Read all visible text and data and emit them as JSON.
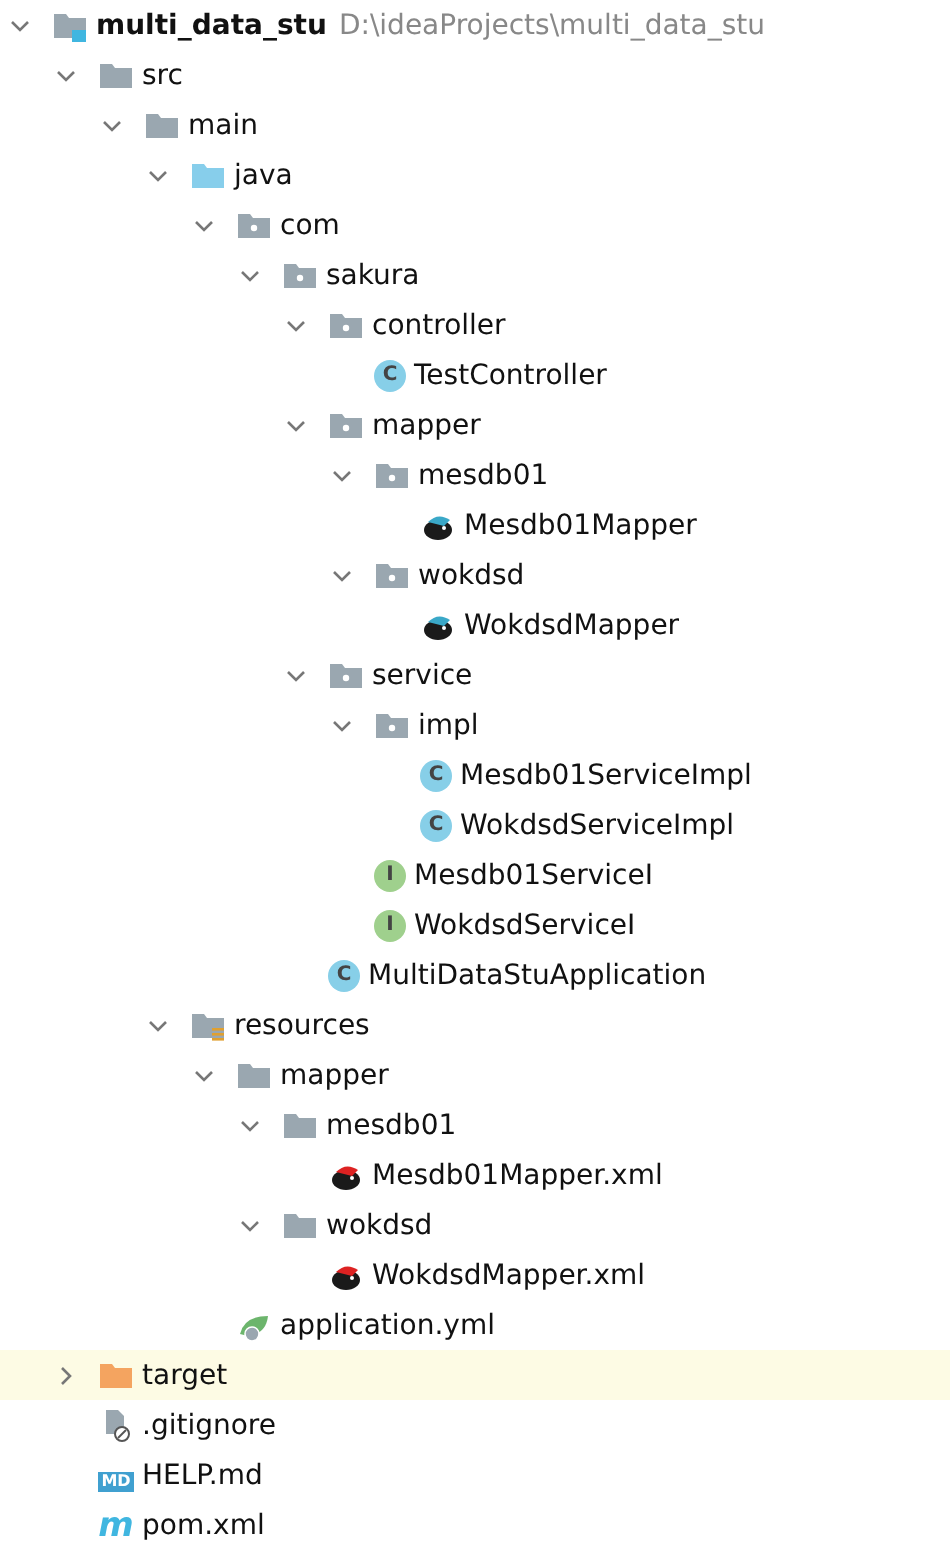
{
  "tree": [
    {
      "kind": "module",
      "name": "multi_data_stu",
      "path": "D:\\ideaProjects\\multi_data_stu",
      "expanded": true,
      "selected": false,
      "children": [
        {
          "kind": "folder",
          "name": "src",
          "expanded": true,
          "selected": false,
          "children": [
            {
              "kind": "folder",
              "name": "main",
              "expanded": true,
              "selected": false,
              "children": [
                {
                  "kind": "source-folder",
                  "name": "java",
                  "expanded": true,
                  "selected": false,
                  "children": [
                    {
                      "kind": "package",
                      "name": "com",
                      "expanded": true,
                      "selected": false,
                      "children": [
                        {
                          "kind": "package",
                          "name": "sakura",
                          "expanded": true,
                          "selected": false,
                          "children": [
                            {
                              "kind": "package",
                              "name": "controller",
                              "expanded": true,
                              "selected": false,
                              "children": [
                                {
                                  "kind": "class",
                                  "name": "TestController",
                                  "icon_label": "C",
                                  "selected": false
                                }
                              ]
                            },
                            {
                              "kind": "package",
                              "name": "mapper",
                              "expanded": true,
                              "selected": false,
                              "children": [
                                {
                                  "kind": "package",
                                  "name": "mesdb01",
                                  "expanded": true,
                                  "selected": false,
                                  "children": [
                                    {
                                      "kind": "mapper",
                                      "name": "Mesdb01Mapper",
                                      "selected": false
                                    }
                                  ]
                                },
                                {
                                  "kind": "package",
                                  "name": "wokdsd",
                                  "expanded": true,
                                  "selected": false,
                                  "children": [
                                    {
                                      "kind": "mapper",
                                      "name": "WokdsdMapper",
                                      "selected": false
                                    }
                                  ]
                                }
                              ]
                            },
                            {
                              "kind": "package",
                              "name": "service",
                              "expanded": true,
                              "selected": false,
                              "children": [
                                {
                                  "kind": "package",
                                  "name": "impl",
                                  "expanded": true,
                                  "selected": false,
                                  "children": [
                                    {
                                      "kind": "class",
                                      "name": "Mesdb01ServiceImpl",
                                      "icon_label": "C",
                                      "selected": false
                                    },
                                    {
                                      "kind": "class",
                                      "name": "WokdsdServiceImpl",
                                      "icon_label": "C",
                                      "selected": false
                                    }
                                  ]
                                },
                                {
                                  "kind": "interface",
                                  "name": "Mesdb01ServiceI",
                                  "icon_label": "I",
                                  "selected": false
                                },
                                {
                                  "kind": "interface",
                                  "name": "WokdsdServiceI",
                                  "icon_label": "I",
                                  "selected": false
                                }
                              ]
                            },
                            {
                              "kind": "app-class",
                              "name": "MultiDataStuApplication",
                              "icon_label": "C",
                              "selected": false
                            }
                          ]
                        }
                      ]
                    }
                  ]
                },
                {
                  "kind": "resources",
                  "name": "resources",
                  "expanded": true,
                  "selected": false,
                  "children": [
                    {
                      "kind": "folder",
                      "name": "mapper",
                      "expanded": true,
                      "selected": false,
                      "children": [
                        {
                          "kind": "folder",
                          "name": "mesdb01",
                          "expanded": true,
                          "selected": false,
                          "children": [
                            {
                              "kind": "xml",
                              "name": "Mesdb01Mapper.xml",
                              "selected": false
                            }
                          ]
                        },
                        {
                          "kind": "folder",
                          "name": "wokdsd",
                          "expanded": true,
                          "selected": false,
                          "children": [
                            {
                              "kind": "xml",
                              "name": "WokdsdMapper.xml",
                              "selected": false
                            }
                          ]
                        }
                      ]
                    },
                    {
                      "kind": "yml",
                      "name": "application.yml",
                      "selected": false
                    }
                  ]
                }
              ]
            }
          ]
        },
        {
          "kind": "excluded",
          "name": "target",
          "expanded": false,
          "selected": true
        },
        {
          "kind": "ignore",
          "name": ".gitignore",
          "selected": false
        },
        {
          "kind": "markdown",
          "name": "HELP.md",
          "icon_label": "MD",
          "selected": false
        },
        {
          "kind": "maven",
          "name": "pom.xml",
          "icon_label": "m",
          "selected": false
        }
      ]
    }
  ]
}
